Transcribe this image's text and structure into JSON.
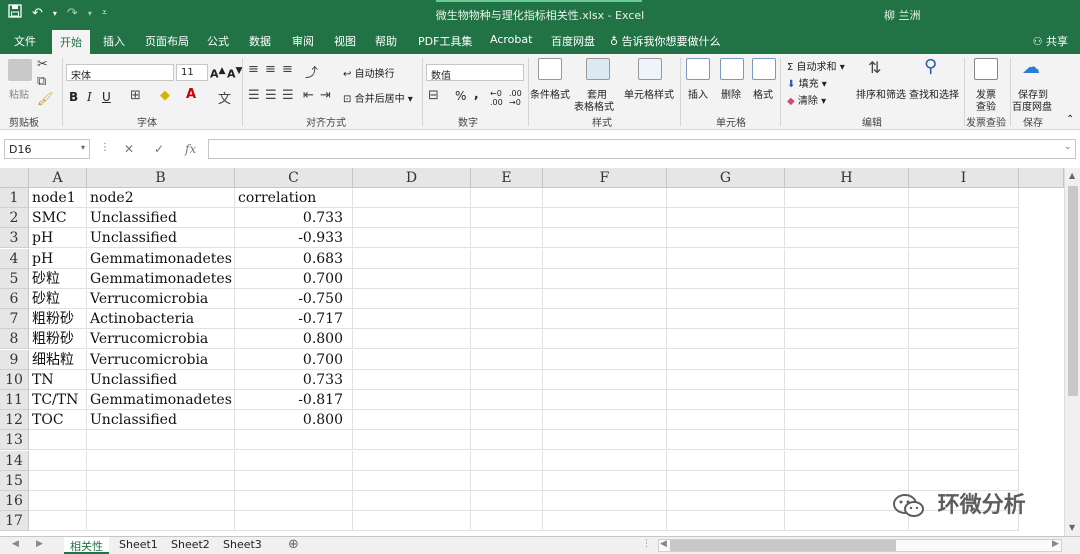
{
  "titlebar": {
    "title": "微生物物种与理化指标相关性.xlsx  -  Excel",
    "user": "柳 兰洲",
    "icons": [
      "save-icon",
      "undo-icon",
      "redo-icon",
      "customize-qat-icon",
      "minimize-icon",
      "restore-icon",
      "close-icon"
    ]
  },
  "ribbon_tabs": {
    "tabs": [
      "文件",
      "开始",
      "插入",
      "页面布局",
      "公式",
      "数据",
      "审阅",
      "视图",
      "帮助",
      "PDF工具集",
      "Acrobat",
      "百度网盘"
    ],
    "active": "开始",
    "tell_me": "告诉我你想要做什么",
    "share": "共享"
  },
  "ribbon": {
    "clipboard": {
      "paste": "粘贴",
      "group": "剪贴板"
    },
    "font": {
      "name": "宋体",
      "size": "11",
      "bold": "B",
      "italic": "I",
      "underline": "U",
      "group": "字体"
    },
    "alignment": {
      "wrap": "自动换行",
      "merge": "合并后居中",
      "group": "对齐方式"
    },
    "number": {
      "format": "数值",
      "percent": "%",
      "comma": ",",
      "group": "数字"
    },
    "styles": {
      "conditional": "条件格式",
      "table_a": "套用",
      "table_b": "表格格式",
      "cell_styles": "单元格样式",
      "group": "样式"
    },
    "cells": {
      "insert": "插入",
      "delete": "删除",
      "format": "格式",
      "group": "单元格"
    },
    "editing": {
      "autosum": "自动求和",
      "fill": "填充",
      "clear": "清除",
      "sort": "排序和筛选",
      "find": "查找和选择",
      "group": "编辑"
    },
    "invoice": {
      "a": "发票",
      "b": "查验",
      "group": "发票查验"
    },
    "save": {
      "a": "保存到",
      "b": "百度网盘",
      "group": "保存"
    }
  },
  "formula_bar": {
    "name_box": "D16",
    "cancel": "✕",
    "enter": "✓",
    "fx": "fx",
    "formula": ""
  },
  "sheet": {
    "columns": [
      "A",
      "B",
      "C",
      "D",
      "E",
      "F",
      "G",
      "H",
      "I"
    ],
    "rows": [
      "1",
      "2",
      "3",
      "4",
      "5",
      "6",
      "7",
      "8",
      "9",
      "10",
      "11",
      "12",
      "13",
      "14",
      "15",
      "16",
      "17"
    ],
    "data": [
      [
        "node1",
        "node2",
        "correlation"
      ],
      [
        "SMC",
        "Unclassified",
        "0.733"
      ],
      [
        "pH",
        "Unclassified",
        "-0.933"
      ],
      [
        "pH",
        "Gemmatimonadetes",
        "0.683"
      ],
      [
        "砂粒",
        "Gemmatimonadetes",
        "0.700"
      ],
      [
        "砂粒",
        "Verrucomicrobia",
        "-0.750"
      ],
      [
        "粗粉砂",
        "Actinobacteria",
        "-0.717"
      ],
      [
        "粗粉砂",
        "Verrucomicrobia",
        "0.800"
      ],
      [
        "细粘粒",
        "Verrucomicrobia",
        "0.700"
      ],
      [
        "TN",
        "Unclassified",
        "0.733"
      ],
      [
        "TC/TN",
        "Gemmatimonadetes",
        "-0.817"
      ],
      [
        "TOC",
        "Unclassified",
        "0.800"
      ]
    ]
  },
  "sheet_tabs": {
    "tabs": [
      "相关性",
      "Sheet1",
      "Sheet2",
      "Sheet3"
    ],
    "active": "相关性",
    "add": "⊕"
  },
  "watermark": "环微分析",
  "colors": {
    "excel_green": "#217346",
    "ribbon_bg": "#f3f3f3",
    "header_bg": "#e6e6e6"
  }
}
